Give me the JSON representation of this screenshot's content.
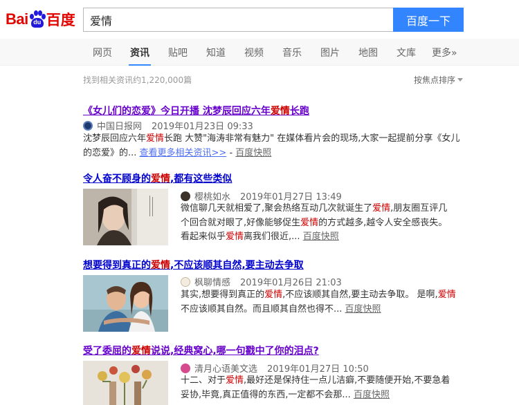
{
  "logo": {
    "latin": "Bai",
    "paw_text": "du",
    "chinese": "百度"
  },
  "search": {
    "query": "爱情",
    "button_label": "百度一下"
  },
  "tabs": [
    {
      "label": "网页"
    },
    {
      "label": "资讯"
    },
    {
      "label": "贴吧"
    },
    {
      "label": "知道"
    },
    {
      "label": "视频"
    },
    {
      "label": "音乐"
    },
    {
      "label": "图片"
    },
    {
      "label": "地图"
    },
    {
      "label": "文库"
    },
    {
      "label": "更多»"
    }
  ],
  "active_tab": "资讯",
  "result_count": "找到相关资讯约1,220,000篇",
  "sort_label": "按焦点排序",
  "colors": {
    "accent": "#3385ff",
    "highlight": "#c00000",
    "link": "#0000cc",
    "visited": "#6600cc"
  },
  "results": [
    {
      "title_parts": [
        "《女儿们的恋爱》今日开播 沈梦辰回应六年",
        "爱情",
        "长跑"
      ],
      "source_icon": "news-source-icon",
      "source": "中国日报网",
      "time": "2019年01月23日 09:33",
      "snippet_lines": [
        [
          "沈梦辰回应六年",
          "爱情",
          "长跑 大赞\"海涛非常有魅力\" 在媒体看片会的现场,大家一起提前分享《女儿"
        ],
        [
          "的恋爱》的... "
        ]
      ],
      "more_link": "查看更多相关资讯>>",
      "separator": " - ",
      "snapshot": "百度快照"
    },
    {
      "title_parts": [
        "令人奋不顾身的",
        "爱情",
        ",都有这些类似"
      ],
      "source": "樱桃如水",
      "time": "2019年01月27日 13:49",
      "snippet_lines": [
        [
          "微信聊几天就相爱了,聚会热络互动几次就诞生了",
          "爱情",
          ",朋友圈互评几"
        ],
        [
          "个回合就对眼了,好像能够促生",
          "爱情",
          "的方式越多,越令人安全感丧失。"
        ],
        [
          "看起来似乎",
          "爱情",
          "离我们很近,... "
        ]
      ],
      "snapshot": "百度快照"
    },
    {
      "title_parts": [
        "想要得到真正的",
        "爱情",
        ",不应该顺其自然,要主动去争取"
      ],
      "source": "枫聊情感",
      "time": "2019年01月26日 21:03",
      "snippet_lines": [
        [
          "其实,想要得到真正的",
          "爱情",
          ",不应该顺其自然,要主动去争取。 是啊,",
          "爱情"
        ],
        [
          "不应该顺其自然。而且顺其自然也得不... "
        ]
      ],
      "snapshot": "百度快照"
    },
    {
      "title_parts": [
        "受了委屈的",
        "爱情",
        "说说,经典窝心,哪一句戳中了你的泪点?"
      ],
      "source": "清月心语美文选",
      "time": "2019年01月27日 10:50",
      "snippet_lines": [
        [
          "十二、对于",
          "爱情",
          ",最好还是保持住一点儿洁癖,不要随便开始,不要急着"
        ],
        [
          "妥协,毕竟,真正值得的东西,一定都不会那... "
        ]
      ],
      "snapshot": "百度快照"
    }
  ]
}
